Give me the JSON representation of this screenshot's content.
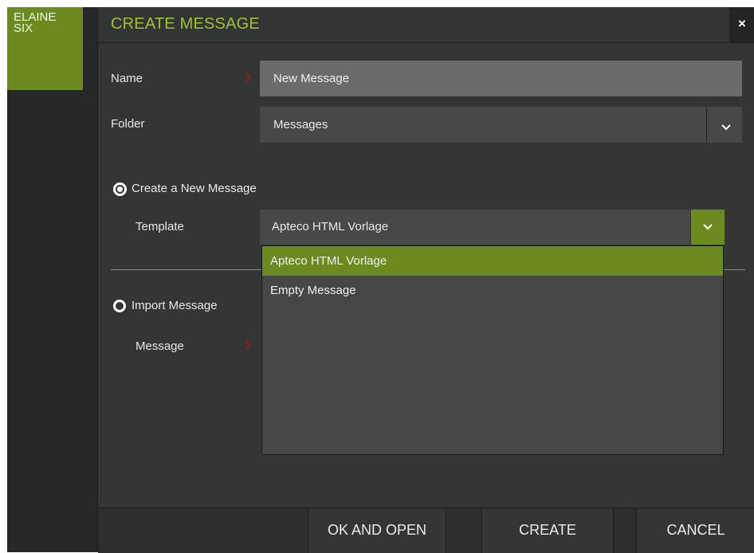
{
  "user": {
    "tile_line1": "ELAINE",
    "tile_line2": "SIX"
  },
  "dialog": {
    "title": "CREATE MESSAGE",
    "close_label": "×",
    "name_label": "Name",
    "name_value": "New Message",
    "folder_label": "Folder",
    "folder_value": "Messages",
    "option_new": {
      "label": "Create a New Message",
      "selected": true
    },
    "template_label": "Template",
    "template_value": "Apteco HTML Vorlage",
    "template_options": [
      "Apteco HTML Vorlage",
      "Empty Message"
    ],
    "option_import": {
      "label": "Import Message",
      "selected": false
    },
    "message_label": "Message",
    "buttons": {
      "ok_open": "OK AND OPEN",
      "create": "CREATE",
      "cancel": "CANCEL"
    }
  },
  "colors": {
    "accent": "#6b8a1f",
    "title": "#9cc32d",
    "required_arrow": "#8a2222",
    "panel": "#343635"
  }
}
